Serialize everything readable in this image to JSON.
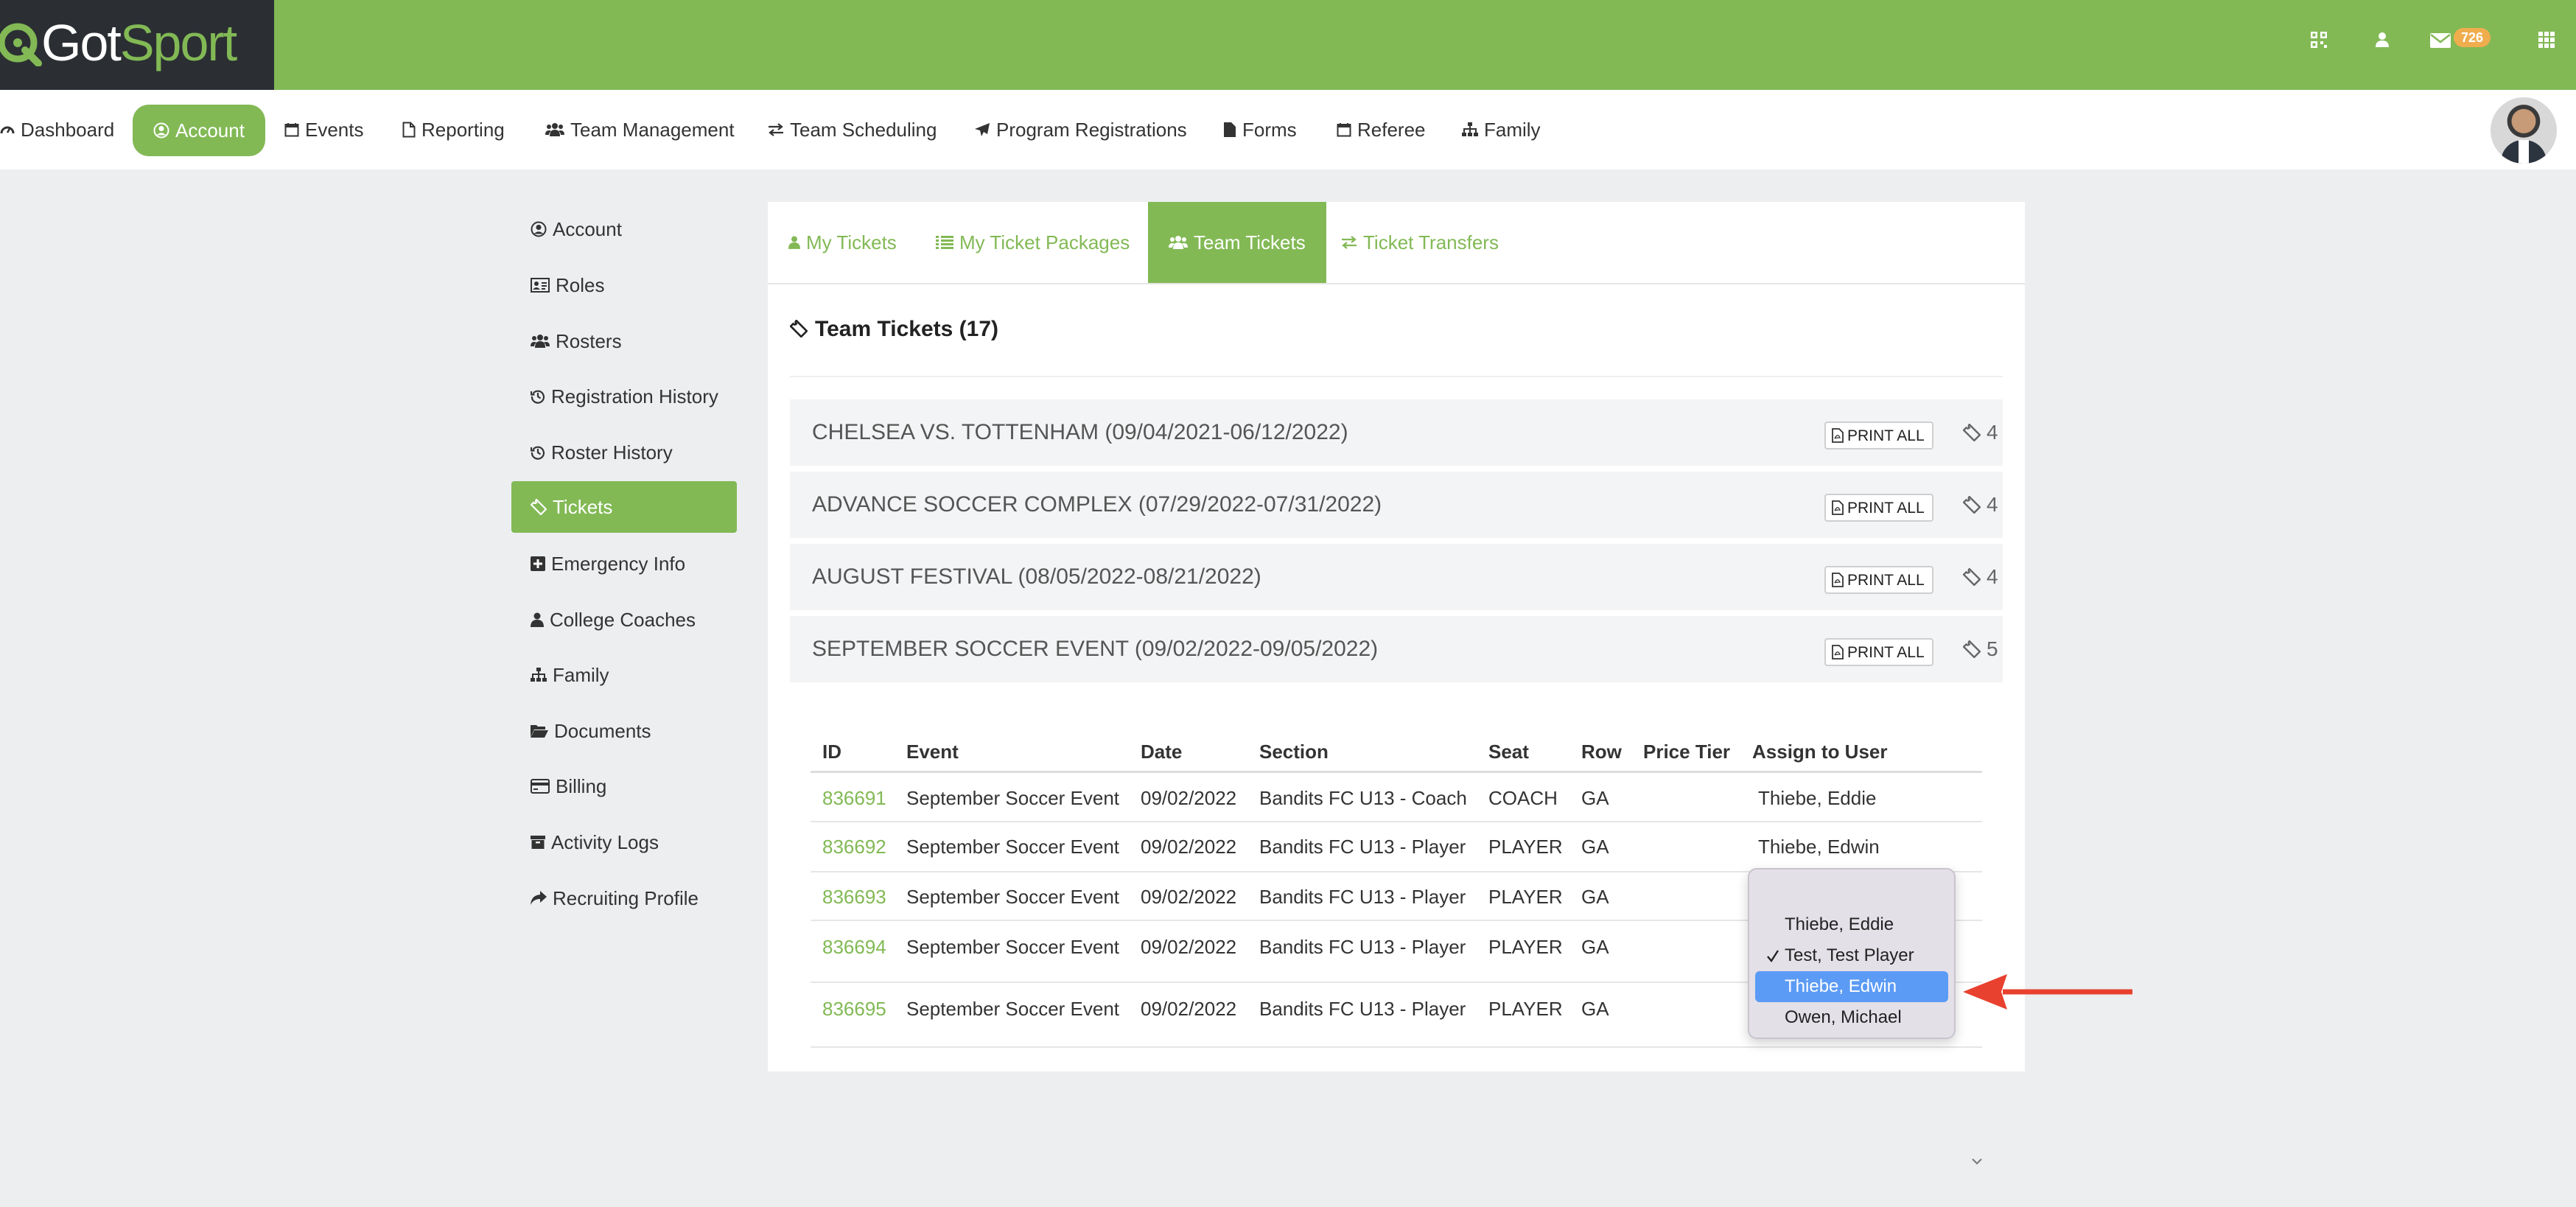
{
  "brand": {
    "logo_got": "Got",
    "logo_sport": "Sport",
    "accent_color": "#82b955"
  },
  "header": {
    "mail_badge": "726"
  },
  "nav": {
    "items": [
      {
        "label": "Dashboard",
        "icon": "dashboard-icon"
      },
      {
        "label": "Account",
        "icon": "user-circle-icon",
        "active": true
      },
      {
        "label": "Events",
        "icon": "calendar-icon"
      },
      {
        "label": "Reporting",
        "icon": "file-icon"
      },
      {
        "label": "Team Management",
        "icon": "users-icon"
      },
      {
        "label": "Team Scheduling",
        "icon": "exchange-icon"
      },
      {
        "label": "Program Registrations",
        "icon": "paper-plane-icon"
      },
      {
        "label": "Forms",
        "icon": "file-icon"
      },
      {
        "label": "Referee",
        "icon": "calendar-icon"
      },
      {
        "label": "Family",
        "icon": "sitemap-icon"
      }
    ]
  },
  "sidebar": {
    "items": [
      {
        "label": "Account",
        "icon": "user-circle-icon"
      },
      {
        "label": "Roles",
        "icon": "id-card-icon"
      },
      {
        "label": "Rosters",
        "icon": "users-icon"
      },
      {
        "label": "Registration History",
        "icon": "history-icon"
      },
      {
        "label": "Roster History",
        "icon": "history-icon"
      },
      {
        "label": "Tickets",
        "icon": "ticket-icon",
        "active": true
      },
      {
        "label": "Emergency Info",
        "icon": "plus-square-icon"
      },
      {
        "label": "College Coaches",
        "icon": "user-icon"
      },
      {
        "label": "Family",
        "icon": "sitemap-icon"
      },
      {
        "label": "Documents",
        "icon": "folder-open-icon"
      },
      {
        "label": "Billing",
        "icon": "credit-card-icon"
      },
      {
        "label": "Activity Logs",
        "icon": "archive-icon"
      },
      {
        "label": "Recruiting Profile",
        "icon": "share-icon"
      }
    ]
  },
  "tabs": [
    {
      "label": "My Tickets",
      "icon": "user-icon"
    },
    {
      "label": "My Ticket Packages",
      "icon": "list-icon"
    },
    {
      "label": "Team Tickets",
      "icon": "users-icon",
      "active": true
    },
    {
      "label": "Ticket Transfers",
      "icon": "exchange-icon"
    }
  ],
  "panel": {
    "title": "Team Tickets (17)"
  },
  "events": [
    {
      "name": "CHELSEA VS. TOTTENHAM (09/04/2021-06/12/2022)",
      "print_label": "PRINT ALL",
      "count": "4"
    },
    {
      "name": "ADVANCE SOCCER COMPLEX (07/29/2022-07/31/2022)",
      "print_label": "PRINT ALL",
      "count": "4"
    },
    {
      "name": "AUGUST FESTIVAL (08/05/2022-08/21/2022)",
      "print_label": "PRINT ALL",
      "count": "4"
    },
    {
      "name": "SEPTEMBER SOCCER EVENT (09/02/2022-09/05/2022)",
      "print_label": "PRINT ALL",
      "count": "5"
    }
  ],
  "table": {
    "headers": [
      "ID",
      "Event",
      "Date",
      "Section",
      "Seat",
      "Row",
      "Price Tier",
      "Assign to User"
    ],
    "rows": [
      {
        "id": "836691",
        "event": "September Soccer Event",
        "date": "09/02/2022",
        "section": "Bandits FC U13 - Coach",
        "seat": "COACH",
        "row": "GA",
        "tier": "",
        "assign": "Thiebe, Eddie"
      },
      {
        "id": "836692",
        "event": "September Soccer Event",
        "date": "09/02/2022",
        "section": "Bandits FC U13 - Player",
        "seat": "PLAYER",
        "row": "GA",
        "tier": "",
        "assign": "Thiebe, Edwin"
      },
      {
        "id": "836693",
        "event": "September Soccer Event",
        "date": "09/02/2022",
        "section": "Bandits FC U13 - Player",
        "seat": "PLAYER",
        "row": "GA",
        "tier": "",
        "assign": ""
      },
      {
        "id": "836694",
        "event": "September Soccer Event",
        "date": "09/02/2022",
        "section": "Bandits FC U13 - Player",
        "seat": "PLAYER",
        "row": "GA",
        "tier": "",
        "assign": ""
      },
      {
        "id": "836695",
        "event": "September Soccer Event",
        "date": "09/02/2022",
        "section": "Bandits FC U13 - Player",
        "seat": "PLAYER",
        "row": "GA",
        "tier": "",
        "assign": ""
      }
    ]
  },
  "dropdown": {
    "options": [
      "",
      "Thiebe, Eddie",
      "Test, Test Player",
      "Thiebe, Edwin",
      "Owen, Michael"
    ],
    "checked": "Test, Test Player",
    "highlighted": "Thiebe, Edwin",
    "highlight_color": "#5b9bf5"
  },
  "annotation_color": "#e8412f"
}
